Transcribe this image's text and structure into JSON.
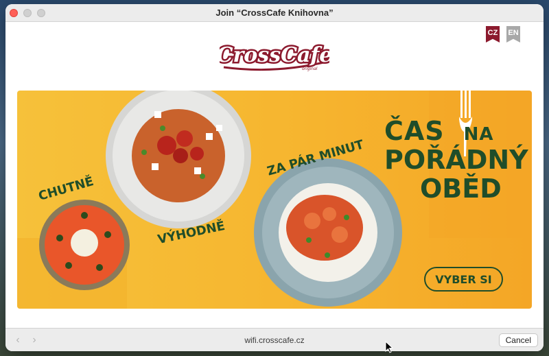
{
  "window": {
    "title": "Join “CrossCafe Knihovna”"
  },
  "lang": {
    "cz": "CZ",
    "en": "EN"
  },
  "logo": {
    "text": "CrossCafe",
    "sub": "original"
  },
  "banner": {
    "headline_1": "ČAS",
    "headline_1_small": "NA",
    "headline_2": "POŘÁDNÝ",
    "headline_3": "OBĚD",
    "tag_chutne": "CHUTNĚ",
    "tag_vyhodne": "VÝHODNĚ",
    "tag_zapar": "ZA PÁR MINUT",
    "cta": "VYBER SI"
  },
  "carousel": {
    "count": 4,
    "active_index": 3
  },
  "bottombar": {
    "url": "wifi.crosscafe.cz",
    "cancel": "Cancel",
    "back": "‹",
    "forward": "›"
  },
  "colors": {
    "brand": "#8c1a2e",
    "green": "#1f4d2a",
    "yellow": "#f6c13a"
  }
}
